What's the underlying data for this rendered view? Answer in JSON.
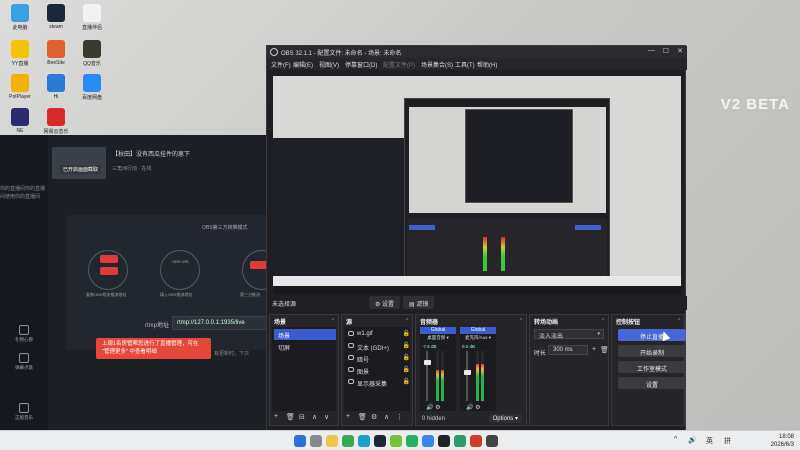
{
  "desktop": {
    "brand": "V2 BETA",
    "icons": [
      {
        "label": "此电脑",
        "color": "#3aa0e0"
      },
      {
        "label": "steam",
        "color": "#1b2838"
      },
      {
        "label": "直播伴侣",
        "color": "#f2f2f2"
      },
      {
        "label": "YY直播",
        "color": "#f5c400"
      },
      {
        "label": "BeeSite",
        "color": "#e06030"
      },
      {
        "label": "QQ音乐",
        "color": "#3a3a2e"
      },
      {
        "label": "PotPlayer",
        "color": "#f0b400"
      },
      {
        "label": "Hi",
        "color": "#2a7cd8"
      },
      {
        "label": "百度网盘",
        "color": "#2a8bf2"
      },
      {
        "label": "NE",
        "color": "#2c2c6e"
      },
      {
        "label": "网易云音乐",
        "color": "#d82a2a"
      }
    ]
  },
  "bg_app": {
    "room_badge": "已开启画面截取",
    "room_title": "【秋田】没有西瓜挂件的崽下",
    "room_sub": "三角洲行动 · 在线",
    "panel_title": "OBS第三方转推模式",
    "flow_labels": [
      "复制OBS相关推流地址",
      "填入OBS推流地址",
      "第三方推流"
    ],
    "flow_middle": "OBS URL",
    "rtmp_label": "rtmp地址",
    "rtmp_value": "rtmp://127.0.0.1:1935/live",
    "toast": "上周1名房管帮您进行了直播管理，可在 \"管理更多\" 中查看明细",
    "note": "有更新时，下次",
    "sidebar_items": [
      "礼物心愿",
      "弹幕点歌",
      "正版音乐"
    ],
    "side_text": "你的直播间你的直播间使用你的直播间"
  },
  "obs": {
    "title": "OBS 32.1.1 - 配置文件: 未命名 - 场景: 未命名",
    "menu": [
      {
        "label": "文件(F)",
        "disabled": false
      },
      {
        "label": "编辑(E)",
        "disabled": false
      },
      {
        "label": "视图(V)",
        "disabled": false
      },
      {
        "label": "停靠窗口(D)",
        "disabled": false
      },
      {
        "label": "配置文件(P)",
        "disabled": true
      },
      {
        "label": "场景集合(S)",
        "disabled": false
      },
      {
        "label": "工具(T)",
        "disabled": false
      },
      {
        "label": "帮助(H)",
        "disabled": false
      }
    ],
    "no_source": "未选择源",
    "settings_btn": "设置",
    "filters_btn": "滤镜",
    "scenes": {
      "title": "场景",
      "items": [
        {
          "label": "场景",
          "selected": true
        },
        {
          "label": "切屏",
          "selected": false
        }
      ]
    },
    "sources": {
      "title": "源",
      "items": [
        "w1.gif",
        "文本 (GDI+)",
        "暗号",
        "图景",
        "显示器采集"
      ]
    },
    "mixer": {
      "title": "音频器",
      "channels": [
        {
          "name": "Global",
          "device": "桌面音频",
          "db": "-7.6 dB",
          "level": 0.62,
          "fader": 0.78
        },
        {
          "name": "Global",
          "device": "麦克风/Aux",
          "db": "0.0 dB",
          "level": 0.74,
          "fader": 0.58
        }
      ],
      "hidden": "0 hidden",
      "options": "Options"
    },
    "transitions": {
      "title": "转场动画",
      "selected": "淡入淡出",
      "duration_label": "时长",
      "duration_value": "300 ms"
    },
    "controls": {
      "title": "控制按钮",
      "buttons": [
        {
          "label": "停止直播",
          "primary": true
        },
        {
          "label": "开始录制",
          "primary": false
        },
        {
          "label": "工作室模式",
          "primary": false
        },
        {
          "label": "设置",
          "primary": false
        }
      ]
    }
  },
  "taskbar": {
    "icons": [
      {
        "name": "windows-start-icon",
        "color": "#2f6fd8"
      },
      {
        "name": "search-icon",
        "color": "#888888"
      },
      {
        "name": "file-explorer-icon",
        "color": "#f2c14e"
      },
      {
        "name": "chrome-icon",
        "color": "#34a853"
      },
      {
        "name": "edge-icon",
        "color": "#1aa0c8"
      },
      {
        "name": "steam-icon",
        "color": "#1b2838"
      },
      {
        "name": "game-icon",
        "color": "#7abf3a"
      },
      {
        "name": "wechat-icon",
        "color": "#2aae67"
      },
      {
        "name": "cloud-icon",
        "color": "#3b86e6"
      },
      {
        "name": "obs-taskbar-icon",
        "color": "#222222"
      },
      {
        "name": "triangle-icon",
        "color": "#2e9c6a"
      },
      {
        "name": "app-red-icon",
        "color": "#d23a2a"
      },
      {
        "name": "app-dark-icon",
        "color": "#444444"
      }
    ],
    "tray": [
      "^",
      "🔊",
      "英",
      "拼"
    ],
    "time": "18:08",
    "date": "2026/6/3"
  }
}
